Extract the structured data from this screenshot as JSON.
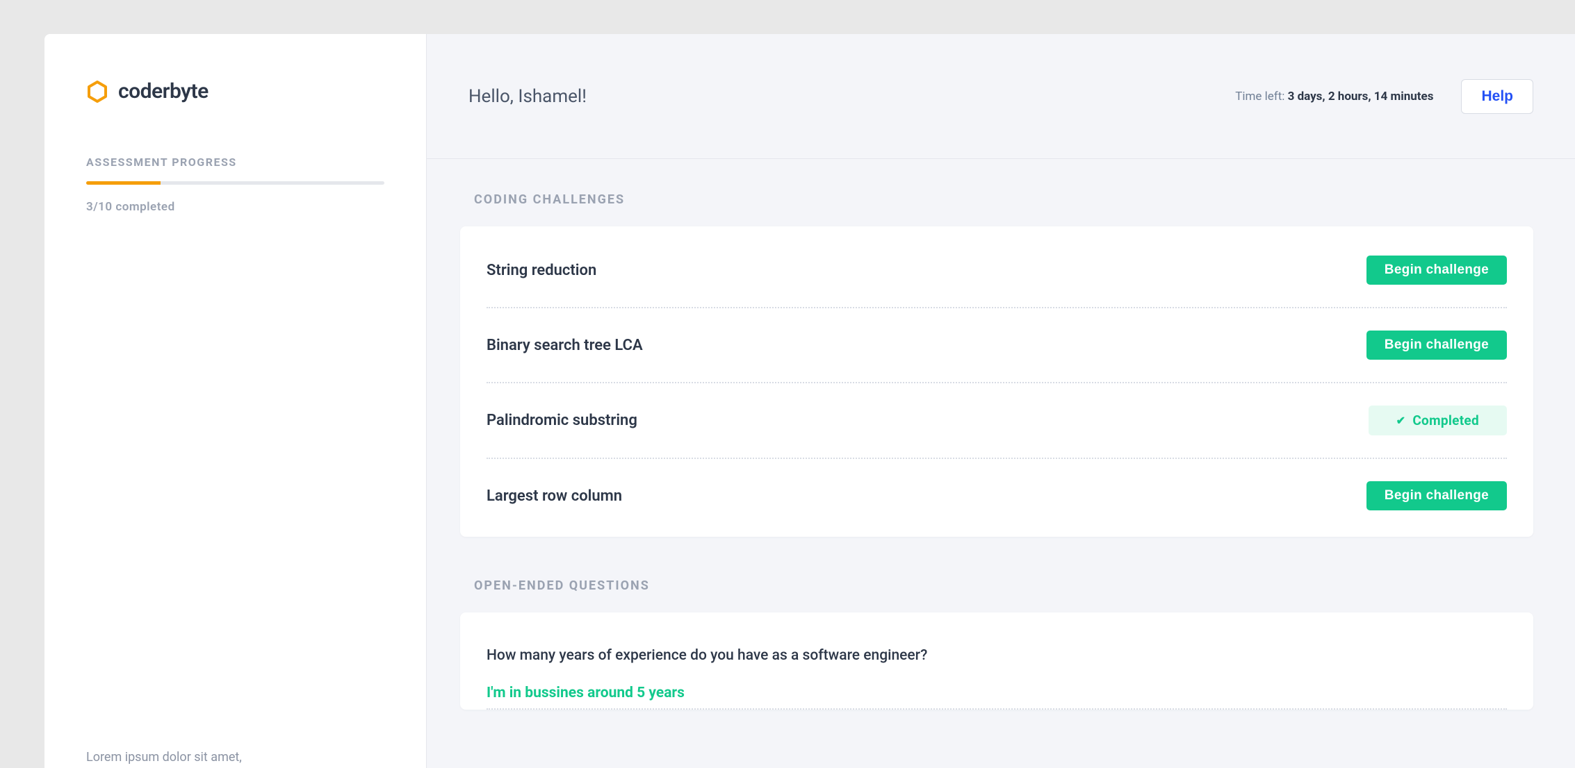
{
  "sidebar": {
    "brand": "coderbyte",
    "section_title": "ASSESSMENT PROGRESS",
    "progress_label": "3/10 completed",
    "progress_percent": 25,
    "footer_text": "Lorem ipsum dolor sit amet,"
  },
  "header": {
    "greeting": "Hello, Ishamel!",
    "time_left_label": "Time left: ",
    "time_left_value": "3 days, 2 hours, 14 minutes",
    "help_label": "Help"
  },
  "challenges": {
    "section_title": "CODING CHALLENGES",
    "begin_label": "Begin challenge",
    "completed_label": "Completed",
    "items": [
      {
        "name": "String reduction",
        "status": "pending"
      },
      {
        "name": "Binary search tree LCA",
        "status": "pending"
      },
      {
        "name": "Palindromic substring",
        "status": "completed"
      },
      {
        "name": "Largest row column",
        "status": "pending"
      }
    ]
  },
  "questions": {
    "section_title": "OPEN-ENDED QUESTIONS",
    "items": [
      {
        "question": "How many years of experience do you have as a software engineer?",
        "answer": "I'm in bussines around 5 years"
      }
    ]
  }
}
